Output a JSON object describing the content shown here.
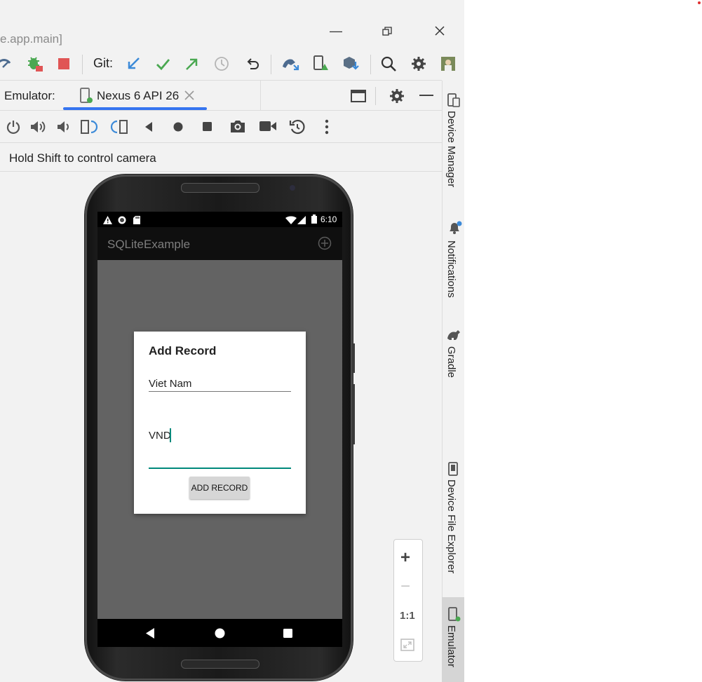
{
  "window": {
    "title": "e.app.main]"
  },
  "toolbar": {
    "git_label": "Git:",
    "icons": [
      "profile-icon",
      "debug-icon",
      "stop-icon",
      "git-update-icon",
      "git-commit-icon",
      "git-push-icon",
      "history-icon",
      "rollback-icon",
      "sync-icon",
      "device-manager-icon",
      "sdk-manager-icon",
      "search-icon",
      "settings-icon",
      "avatar"
    ]
  },
  "emulator": {
    "panel_label": "Emulator:",
    "tab_label": "Nexus 6 API 26",
    "hint": "Hold Shift to control camera"
  },
  "device": {
    "time": "6:10",
    "app_title": "SQLiteExample",
    "dialog": {
      "title": "Add Record",
      "field1_value": "Viet Nam",
      "field2_value": "VND",
      "button_label": "ADD RECORD"
    }
  },
  "zoom": {
    "plus": "+",
    "minus": "−",
    "actual": "1:1"
  },
  "right_strip": {
    "device_manager": "Device Manager",
    "notifications": "Notifications",
    "gradle": "Gradle",
    "device_file_explorer": "Device File Explorer",
    "emulator": "Emulator"
  },
  "colors": {
    "accent": "#3574f0",
    "stop_red": "#e05555",
    "git_blue": "#3c8ad8",
    "git_green": "#4aa851",
    "input_teal": "#00897b"
  }
}
